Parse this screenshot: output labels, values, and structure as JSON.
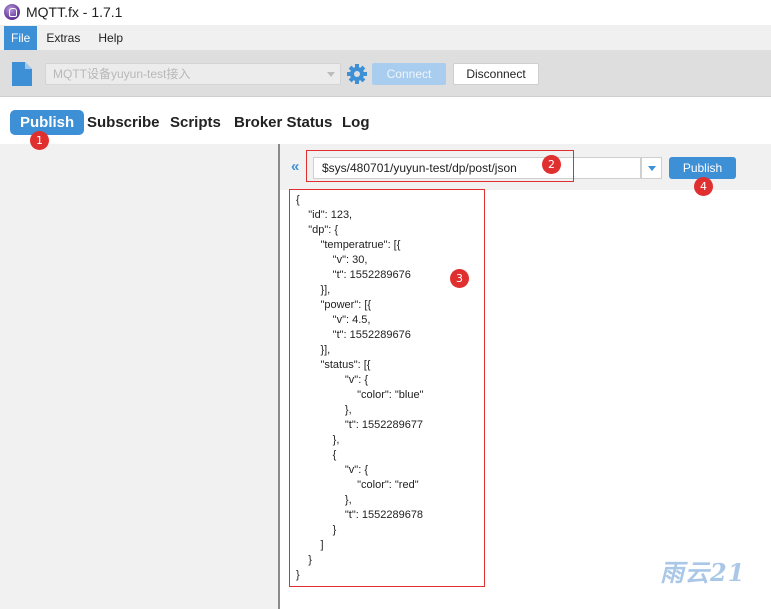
{
  "window": {
    "title": "MQTT.fx - 1.7.1"
  },
  "menu": {
    "items": [
      "File",
      "Extras",
      "Help"
    ]
  },
  "toolbar": {
    "profile": "MQTT设备yuyun-test接入",
    "connect_label": "Connect",
    "disconnect_label": "Disconnect"
  },
  "tabs": [
    "Publish",
    "Subscribe",
    "Scripts",
    "Broker Status",
    "Log"
  ],
  "publish": {
    "topic": "$sys/480701/yuyun-test/dp/post/json",
    "publish_label": "Publish",
    "payload_lines": [
      "{",
      "    \"id\": 123,",
      "    \"dp\": {",
      "        \"temperatrue\": [{",
      "            \"v\": 30,",
      "            \"t\": 1552289676",
      "        }],",
      "        \"power\": [{",
      "            \"v\": 4.5,",
      "            \"t\": 1552289676",
      "        }],",
      "        \"status\": [{",
      "                \"v\": {",
      "                    \"color\": \"blue\"",
      "                },",
      "                \"t\": 1552289677",
      "            },",
      "            {",
      "                \"v\": {",
      "                    \"color\": \"red\"",
      "                },",
      "                \"t\": 1552289678",
      "            }",
      "        ]",
      "    }",
      "}"
    ]
  },
  "annotations": {
    "badge1": "1",
    "badge2": "2",
    "badge3": "3",
    "badge4": "4"
  },
  "watermark": "雨云21",
  "colors": {
    "accent": "#3d8fd6",
    "annotation": "#e02f2f"
  }
}
